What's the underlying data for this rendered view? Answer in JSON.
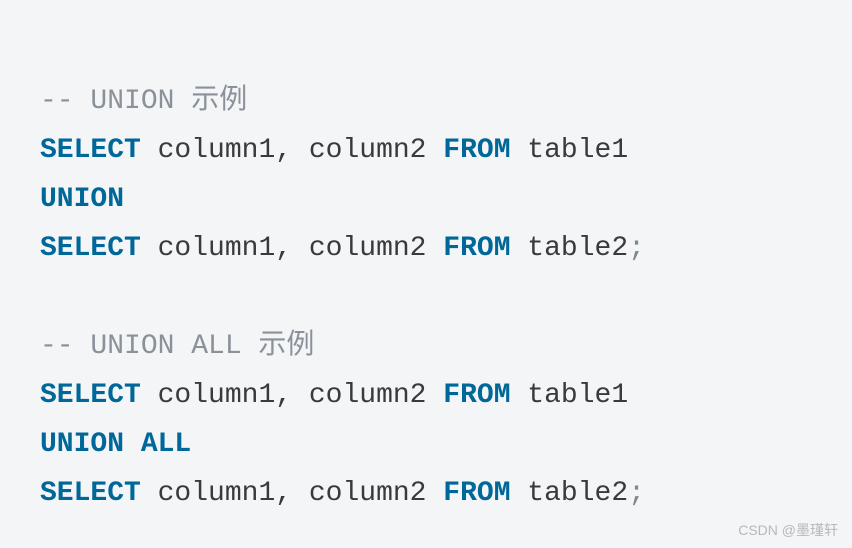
{
  "code": {
    "line1_comment": "-- UNION 示例",
    "line2_select": "SELECT",
    "line2_cols": " column1, column2 ",
    "line2_from": "FROM",
    "line2_table": " table1",
    "line3_union": "UNION",
    "line4_select": "SELECT",
    "line4_cols": " column1, column2 ",
    "line4_from": "FROM",
    "line4_table": " table2",
    "line4_semi": ";",
    "line6_comment": "-- UNION ALL 示例",
    "line7_select": "SELECT",
    "line7_cols": " column1, column2 ",
    "line7_from": "FROM",
    "line7_table": " table1",
    "line8_unionall": "UNION ALL",
    "line9_select": "SELECT",
    "line9_cols": " column1, column2 ",
    "line9_from": "FROM",
    "line9_table": " table2",
    "line9_semi": ";"
  },
  "watermark": "CSDN @墨瑾轩"
}
